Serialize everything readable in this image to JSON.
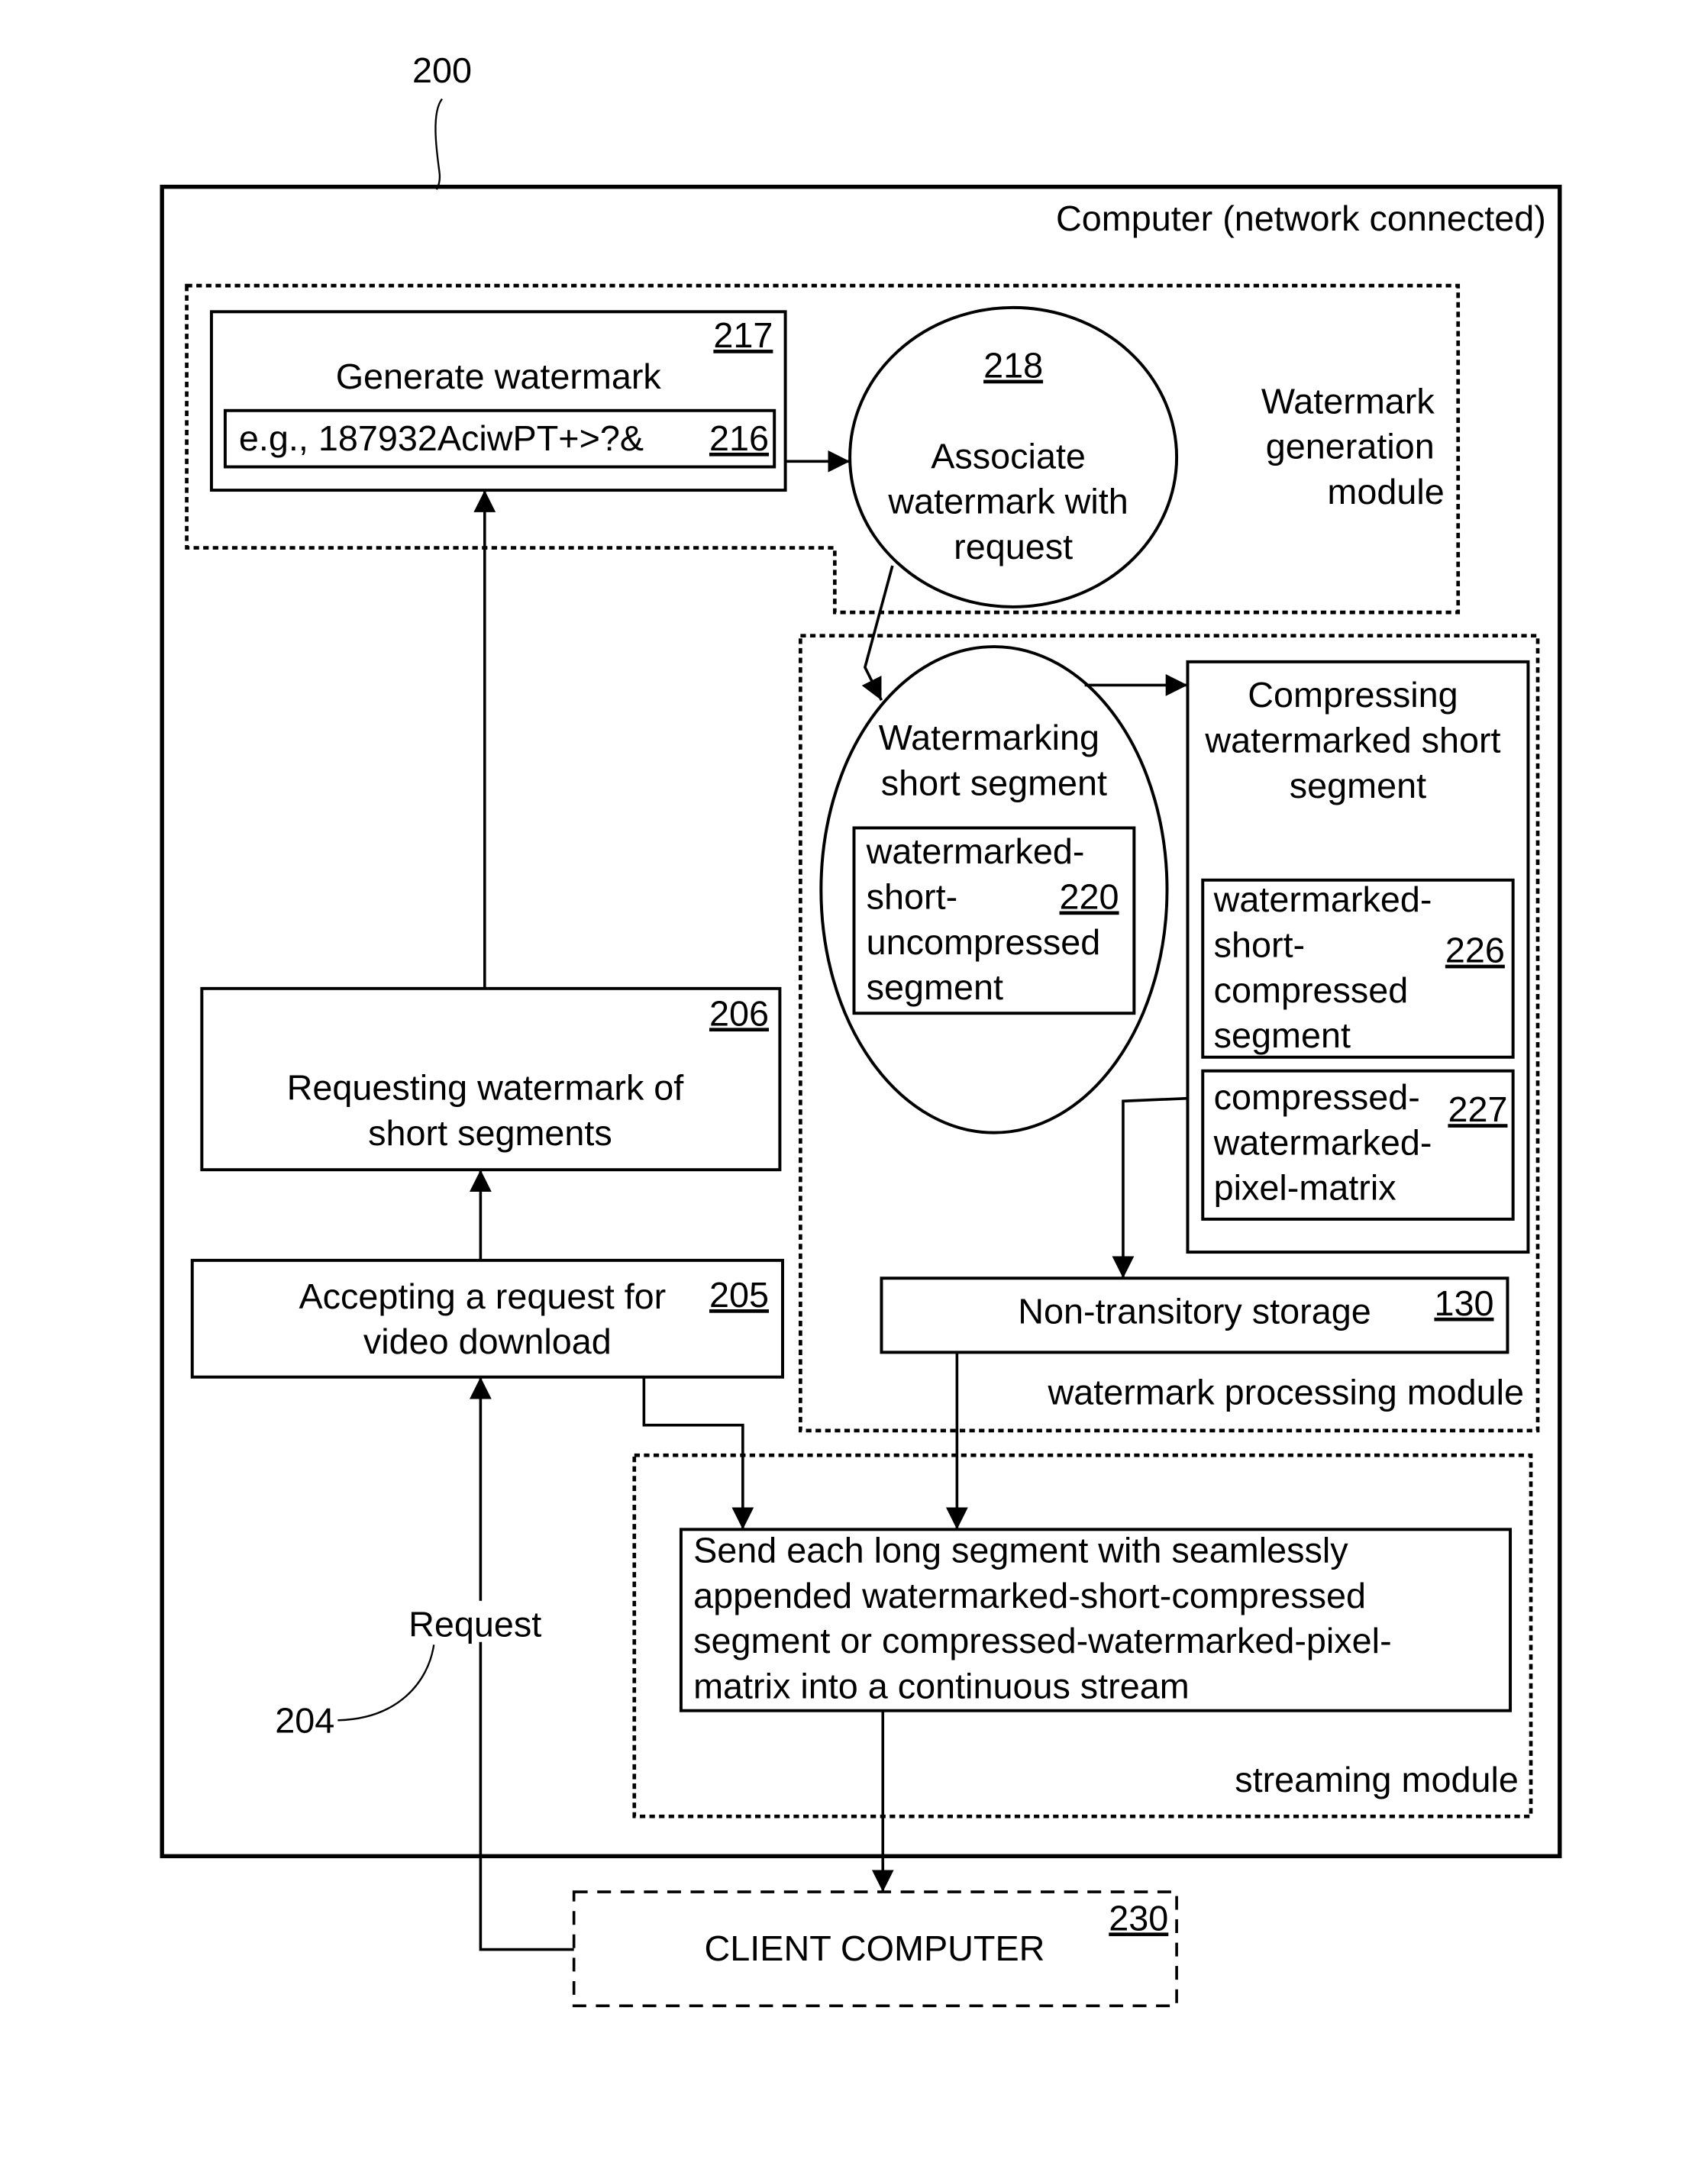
{
  "figure": {
    "ref_number": "200",
    "computer_label": "Computer (network connected)"
  },
  "watermark_generation_module": {
    "label_lines": [
      "Watermark",
      "generation",
      "module"
    ],
    "generate_box": {
      "ref": "217",
      "title": "Generate watermark",
      "example_text": "e.g., 187932AciwPT+>?&",
      "example_ref": "216"
    },
    "associate": {
      "ref": "218",
      "lines": [
        "Associate",
        "watermark with",
        "request"
      ]
    }
  },
  "watermark_processing_module": {
    "label": "watermark processing module",
    "watermarking": {
      "lines": [
        "Watermarking",
        "short segment"
      ],
      "inner_lines": [
        "watermarked-",
        "short-",
        "uncompressed",
        "segment"
      ],
      "inner_ref": "220"
    },
    "compressing": {
      "lines": [
        "Compressing",
        "watermarked short",
        "segment"
      ],
      "item_226_lines": [
        "watermarked-",
        "short-",
        "compressed",
        "segment"
      ],
      "item_226_ref": "226",
      "item_227_lines": [
        "compressed-",
        "watermarked-",
        "pixel-matrix"
      ],
      "item_227_ref": "227"
    },
    "storage": {
      "label": "Non-transitory storage",
      "ref": "130"
    }
  },
  "left_flow": {
    "requesting": {
      "ref": "206",
      "lines": [
        "Requesting watermark of",
        "short segments"
      ]
    },
    "accepting": {
      "ref": "205",
      "lines": [
        "Accepting a request for",
        "video download"
      ]
    },
    "request_label": "Request",
    "request_ref": "204"
  },
  "streaming_module": {
    "label": "streaming module",
    "send_lines": [
      "Send each long segment with seamlessly",
      "appended watermarked-short-compressed",
      "segment or compressed-watermarked-pixel-",
      "matrix into a continuous stream"
    ]
  },
  "client": {
    "label": "CLIENT COMPUTER",
    "ref": "230"
  }
}
